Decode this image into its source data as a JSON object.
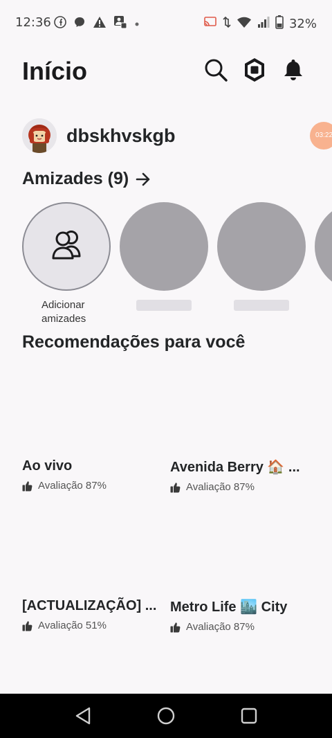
{
  "status_bar": {
    "time": "12:36",
    "battery": "32%"
  },
  "header": {
    "title": "Início"
  },
  "profile": {
    "username": "dbskhvskgb"
  },
  "overlay": {
    "timer": "03:22"
  },
  "friends": {
    "title": "Amizades (9)",
    "add_label": "Adicionar amizades"
  },
  "recommendations": {
    "title": "Recomendações para você",
    "games": [
      {
        "title": "Ao vivo",
        "rating": "Avaliação 87%"
      },
      {
        "title": "Avenida Berry 🏠 ...",
        "rating": "Avaliação 87%"
      },
      {
        "title": "[ACTUALIZAÇÃO] ...",
        "rating": "Avaliação 51%"
      },
      {
        "title": "Metro Life 🏙️ City",
        "rating": "Avaliação 87%"
      }
    ]
  }
}
